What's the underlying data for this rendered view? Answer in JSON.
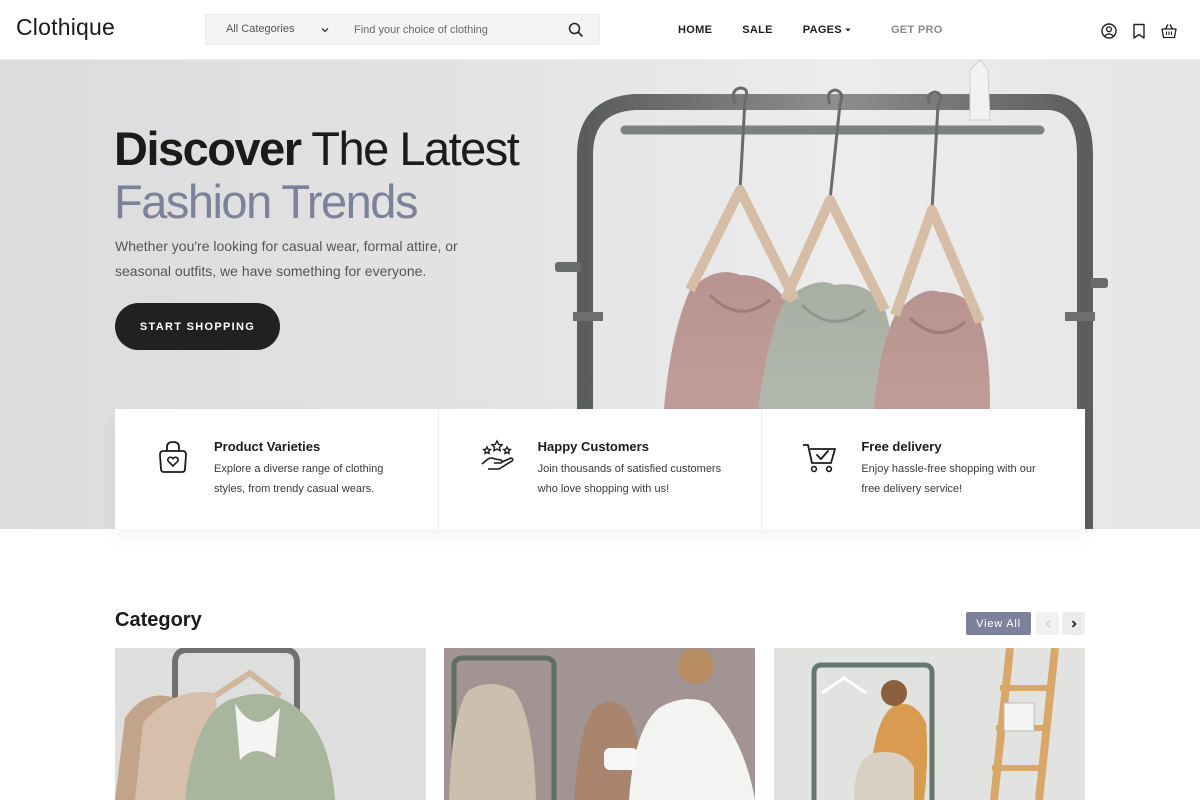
{
  "header": {
    "logo": "Clothique",
    "search": {
      "category_selected": "All Categories",
      "placeholder": "Find your choice of clothing",
      "search_icon": "search-icon"
    },
    "nav": [
      {
        "label": "HOME"
      },
      {
        "label": "SALE"
      },
      {
        "label": "PAGES",
        "icon": "caret-down-icon"
      },
      {
        "label": "GET PRO"
      }
    ],
    "icons": [
      "user-icon",
      "bookmark-icon",
      "basket-icon"
    ]
  },
  "hero": {
    "title_line1_bold": "Discover",
    "title_line1_light": "The Latest",
    "title_line2": "Fashion Trends",
    "subtitle": "Whether you're looking for casual wear, formal attire, or seasonal outfits, we have something for everyone.",
    "cta_label": "START SHOPPING"
  },
  "features": [
    {
      "icon": "shopping-bag-heart-icon",
      "title": "Product Varieties",
      "description": "Explore a diverse range of clothing styles, from trendy casual wears."
    },
    {
      "icon": "hand-stars-icon",
      "title": "Happy Customers",
      "description": "Join thousands of satisfied customers who love shopping with us!"
    },
    {
      "icon": "cart-check-icon",
      "title": "Free delivery",
      "description": "Enjoy hassle-free shopping with our free delivery service!"
    }
  ],
  "category": {
    "title": "Category",
    "view_all_label": "View All",
    "prev_icon": "chevron-left-icon",
    "next_icon": "chevron-right-icon",
    "cards": [
      "category-image-1",
      "category-image-2",
      "category-image-3"
    ]
  },
  "colors": {
    "accent": "#7d8199",
    "dark": "#202122",
    "hero_bg": "#e3e3e4"
  }
}
